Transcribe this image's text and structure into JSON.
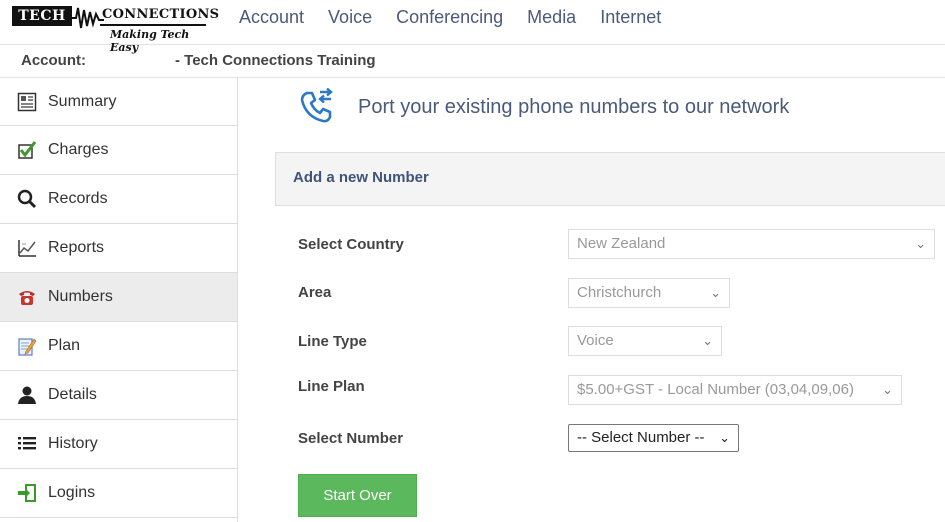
{
  "logo": {
    "brand_left": "TECH",
    "brand_right": "CONNECTIONS",
    "tagline": "Making Tech Easy"
  },
  "nav": {
    "items": [
      "Account",
      "Voice",
      "Conferencing",
      "Media",
      "Internet"
    ]
  },
  "breadcrumb": {
    "label": "Account:",
    "value": "-  Tech Connections Training"
  },
  "sidebar": {
    "items": [
      {
        "label": "Summary",
        "icon": "summary-icon"
      },
      {
        "label": "Charges",
        "icon": "checkmark-icon"
      },
      {
        "label": "Records",
        "icon": "search-icon"
      },
      {
        "label": "Reports",
        "icon": "chart-icon"
      },
      {
        "label": "Numbers",
        "icon": "telephone-icon",
        "active": true
      },
      {
        "label": "Plan",
        "icon": "notepad-icon"
      },
      {
        "label": "Details",
        "icon": "person-icon"
      },
      {
        "label": "History",
        "icon": "list-icon"
      },
      {
        "label": "Logins",
        "icon": "login-icon"
      }
    ]
  },
  "main": {
    "heading": "Port your existing phone numbers to our network",
    "panel_title": "Add a new Number",
    "form": {
      "country_label": "Select Country",
      "country_value": "New Zealand",
      "area_label": "Area",
      "area_value": "Christchurch",
      "line_type_label": "Line Type",
      "line_type_value": "Voice",
      "line_plan_label": "Line Plan",
      "line_plan_value": "$5.00+GST - Local Number (03,04,09,06)",
      "number_label": "Select Number",
      "number_value": "-- Select Number --"
    },
    "start_over_label": "Start Over"
  },
  "colors": {
    "accent": "#4a5a7a",
    "button": "#5cb85c",
    "panel": "#f4f4f4"
  }
}
